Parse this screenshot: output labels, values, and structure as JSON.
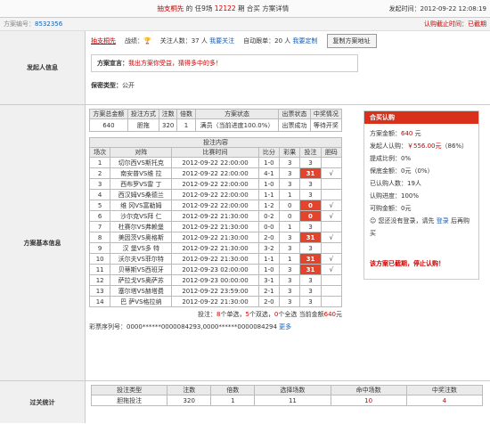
{
  "header": {
    "left": "抽支桐先",
    "middle_before": " 的 任9场 ",
    "issue": "12122",
    "middle_after": " 期 合买 方案详情",
    "time": "发起时间：2012-09-22 12:08:19"
  },
  "sub": {
    "label": "方案编号：",
    "id": "8532356",
    "status": "认购截止时间：已截期"
  },
  "initiator": {
    "section": "发起人信息",
    "name": "抽支桐先",
    "record_label": "战绩：",
    "follow_label": "关注人数：",
    "follow_count": "37",
    "follow_unit": " 人",
    "follow_link": "我要关注",
    "auto_label": "自动跟单：",
    "auto_count": "20",
    "auto_unit": " 人",
    "auto_link": "我要定制",
    "copy_btn": "复制方案地址",
    "declare_label": "方案宣言：",
    "declare": "我出方案你受益，猜得多中的多！",
    "secrecy_label": "保密类型：",
    "secrecy": "公开"
  },
  "summary": {
    "headers": [
      "方案总金额",
      "投注方式",
      "注数",
      "倍数",
      "方案状态",
      "出票状态",
      "中奖情况"
    ],
    "row": [
      "640",
      "胆拖",
      "320",
      "1",
      "满员（当前进度100.0%）",
      "出票成功",
      "等待开奖"
    ]
  },
  "bets": {
    "caption": "投注内容",
    "headers": [
      "场次",
      "对阵",
      "比赛时间",
      "比分",
      "彩果",
      "投注",
      "胆码"
    ],
    "rows": [
      [
        "1",
        "切尔西VS斯托克",
        "2012-09-22 22:00:00",
        "1-0",
        "3",
        "3",
        ""
      ],
      [
        "2",
        "南安普VS维 拉",
        "2012-09-22 22:00:00",
        "4-1",
        "3",
        "31",
        "√"
      ],
      [
        "3",
        "西布罗VS雷 丁",
        "2012-09-22 22:00:00",
        "1-0",
        "3",
        "3",
        ""
      ],
      [
        "4",
        "西汉姆VS桑德兰",
        "2012-09-22 22:00:00",
        "1-1",
        "1",
        "3",
        ""
      ],
      [
        "5",
        "维 冈VS富勒姆",
        "2012-09-22 22:00:00",
        "1-2",
        "0",
        "0",
        "√"
      ],
      [
        "6",
        "沙尔克VS拜 仁",
        "2012-09-22 21:30:00",
        "0-2",
        "0",
        "0",
        "√"
      ],
      [
        "7",
        "杜赛尔VS弗赖堡",
        "2012-09-22 21:30:00",
        "0-0",
        "1",
        "3",
        ""
      ],
      [
        "8",
        "美因茨VS奥格斯",
        "2012-09-22 21:30:00",
        "2-0",
        "3",
        "31",
        "√"
      ],
      [
        "9",
        "汉 堡VS多 特",
        "2012-09-22 21:30:00",
        "3-2",
        "3",
        "3",
        ""
      ],
      [
        "10",
        "沃尔夫VS菲尔特",
        "2012-09-22 21:30:00",
        "1-1",
        "1",
        "31",
        "√"
      ],
      [
        "11",
        "贝蒂斯VS西班牙",
        "2012-09-23 02:00:00",
        "1-0",
        "3",
        "31",
        "√"
      ],
      [
        "12",
        "萨拉戈VS奥萨苏",
        "2012-09-23 00:00:00",
        "3-1",
        "3",
        "3",
        ""
      ],
      [
        "13",
        "塞尔塔VS赫塔费",
        "2012-09-22 23:59:00",
        "2-1",
        "3",
        "3",
        ""
      ],
      [
        "14",
        "巴 萨VS格拉纳",
        "2012-09-22 21:30:00",
        "2-0",
        "3",
        "3",
        ""
      ]
    ],
    "red_cells": [
      1,
      4,
      5,
      7,
      9,
      10
    ],
    "note1": "投注：",
    "single": "8",
    "note2": "个单选，",
    "double": "5",
    "note3": "个双选，",
    "zero": "0",
    "note4": "个全选 当前金额",
    "amount": "640",
    "note5": "元",
    "serial_label": "彩票序列号：",
    "serial": "0000******0000084293,0000******0000084294",
    "serial_more": "更多"
  },
  "buy": {
    "title": "合买认购",
    "total_label": "方案金额：",
    "total": "640",
    "total_unit": " 元",
    "init_label": "发起人认购：",
    "init_amount": "￥556.00元",
    "init_pct": "（86%）",
    "commission_label": "提成比例：",
    "commission": "0%",
    "guarantee_label": "保底金额：",
    "guarantee": "0元（0%）",
    "joined_label": "已认购人数：",
    "joined": "19人",
    "progress_label": "认购进度：",
    "progress": "100%",
    "available_label": "可购金额：",
    "available": "0元",
    "login_pre": "您还没有登录，请先 ",
    "login_link": "登录",
    "login_post": " 后再购买",
    "stopped": "该方案已截期，停止认购！"
  },
  "section_labels": {
    "basic": "方案基本信息",
    "pass": "过关统计"
  },
  "pass": {
    "headers": [
      "投注类型",
      "注数",
      "倍数",
      "选择场数",
      "命中场数",
      "中奖注数"
    ],
    "row": [
      "胆拖投注",
      "320",
      "1",
      "11",
      "10",
      "4"
    ]
  }
}
